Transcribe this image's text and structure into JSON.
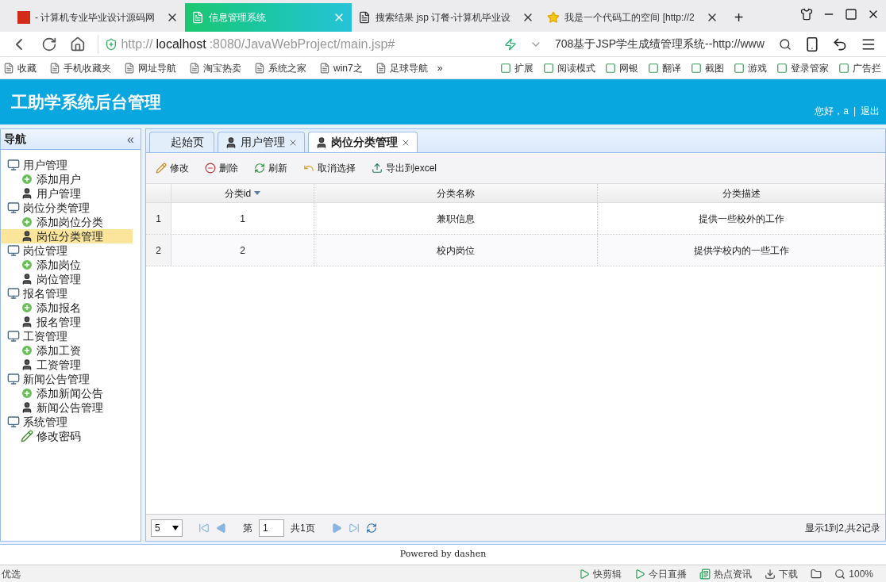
{
  "browser": {
    "tabs": [
      {
        "title": "- 计算机专业毕业设计源码网",
        "selected": false,
        "kind": "logo"
      },
      {
        "title": "信息管理系统",
        "selected": true,
        "kind": "page"
      },
      {
        "title": "搜索结果 jsp 订餐-计算机毕业设",
        "selected": false,
        "kind": "page"
      },
      {
        "title": "我是一个代码工的空间 [http://2",
        "selected": false,
        "kind": "star"
      }
    ],
    "new_tab": "+",
    "address": {
      "scheme": "http://",
      "host": "localhost",
      "rest": ":8080/JavaWebProject/main.jsp#"
    },
    "search": {
      "value": "708基于JSP学生成绩管理系统--http://www"
    },
    "bookmarks_left": [
      "收藏",
      "手机收藏夹",
      "网址导航",
      "淘宝热卖",
      "系统之家",
      "win7之",
      "足球导航"
    ],
    "bookmarks_more": "»",
    "bookmarks_right": [
      "扩展",
      "阅读模式",
      "网银",
      "翻译",
      "截图",
      "游戏",
      "登录管家",
      "广告拦"
    ]
  },
  "header": {
    "title": "工助学系统后台管理",
    "greeting": "您好，a",
    "separator": "|",
    "logout": "退出"
  },
  "nav": {
    "title": "导航",
    "collapse": "«",
    "tree": [
      {
        "label": "用户管理",
        "kind": "folder",
        "selected": false,
        "children": [
          {
            "label": "添加用户",
            "kind": "add",
            "selected": false
          },
          {
            "label": "用户管理",
            "kind": "user",
            "selected": false
          }
        ]
      },
      {
        "label": "岗位分类管理",
        "kind": "folder",
        "selected": false,
        "children": [
          {
            "label": "添加岗位分类",
            "kind": "add",
            "selected": false
          },
          {
            "label": "岗位分类管理",
            "kind": "user",
            "selected": true
          }
        ]
      },
      {
        "label": "岗位管理",
        "kind": "folder",
        "selected": false,
        "children": [
          {
            "label": "添加岗位",
            "kind": "add",
            "selected": false
          },
          {
            "label": "岗位管理",
            "kind": "user",
            "selected": false
          }
        ]
      },
      {
        "label": "报名管理",
        "kind": "folder",
        "selected": false,
        "children": [
          {
            "label": "添加报名",
            "kind": "add",
            "selected": false
          },
          {
            "label": "报名管理",
            "kind": "user",
            "selected": false
          }
        ]
      },
      {
        "label": "工资管理",
        "kind": "folder",
        "selected": false,
        "children": [
          {
            "label": "添加工资",
            "kind": "add",
            "selected": false
          },
          {
            "label": "工资管理",
            "kind": "user",
            "selected": false
          }
        ]
      },
      {
        "label": "新闻公告管理",
        "kind": "folder",
        "selected": false,
        "children": [
          {
            "label": "添加新闻公告",
            "kind": "add",
            "selected": false
          },
          {
            "label": "新闻公告管理",
            "kind": "user",
            "selected": false
          }
        ]
      },
      {
        "label": "系统管理",
        "kind": "folder",
        "selected": false,
        "children": [
          {
            "label": "修改密码",
            "kind": "edit",
            "selected": false
          }
        ]
      }
    ]
  },
  "content_tabs": [
    {
      "label": "起始页",
      "selected": false,
      "closable": false
    },
    {
      "label": "用户管理",
      "selected": false,
      "closable": true
    },
    {
      "label": "岗位分类管理",
      "selected": true,
      "closable": true
    }
  ],
  "toolbar": [
    {
      "label": "修改",
      "kind": "edit"
    },
    {
      "label": "删除",
      "kind": "delete"
    },
    {
      "label": "刷新",
      "kind": "refresh"
    },
    {
      "label": "取消选择",
      "kind": "undo"
    },
    {
      "label": "导出到excel",
      "kind": "export"
    }
  ],
  "table": {
    "columns": [
      {
        "label": "分类id",
        "sorted": true
      },
      {
        "label": "分类名称",
        "sorted": false
      },
      {
        "label": "分类描述",
        "sorted": false
      }
    ],
    "rows": [
      {
        "index": "1",
        "cells": [
          "1",
          "兼职信息",
          "提供一些校外的工作"
        ]
      },
      {
        "index": "2",
        "cells": [
          "2",
          "校内岗位",
          "提供学校内的一些工作"
        ]
      }
    ]
  },
  "pager": {
    "page_size": "5",
    "page_prefix": "第",
    "page": "1",
    "total_pages": "共1页",
    "info": "显示1到2,共2记录"
  },
  "footer": "Powered by dashen",
  "status_bar": {
    "left": "优选",
    "items": [
      "快剪辑",
      "今日直播",
      "热点资讯",
      "下载"
    ],
    "zoom": "100%"
  }
}
